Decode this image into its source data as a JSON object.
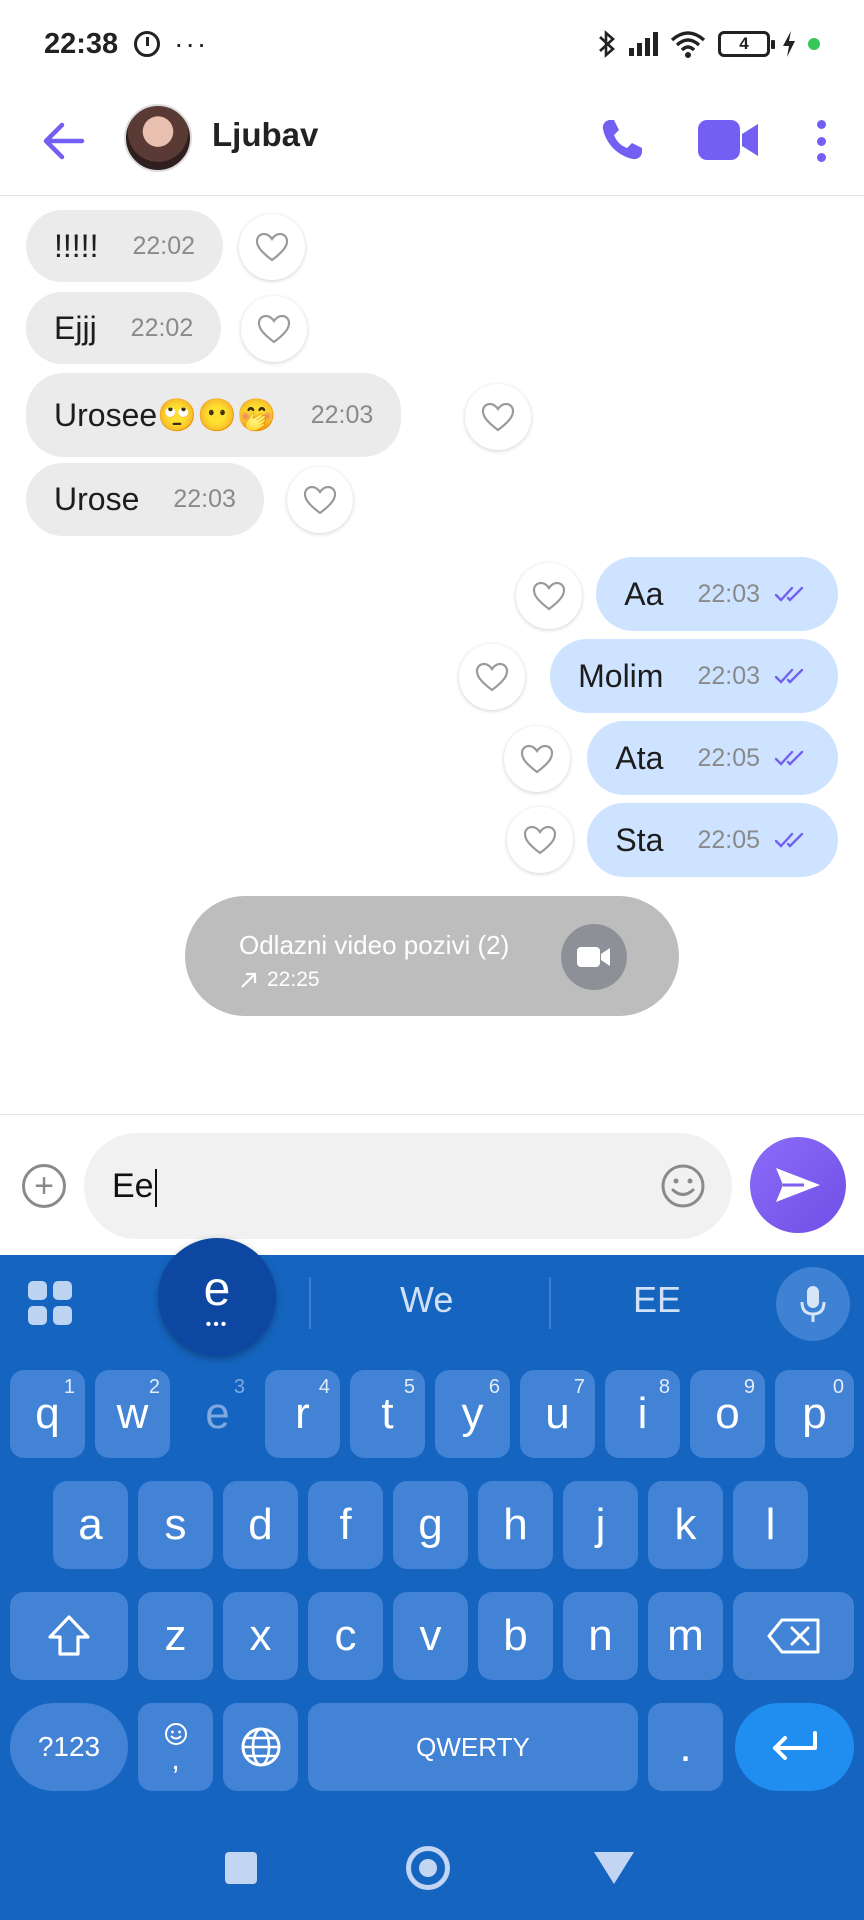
{
  "status_bar": {
    "time": "22:38",
    "dots": "···",
    "battery": "4"
  },
  "header": {
    "contact_name": "Ljubav"
  },
  "messages": {
    "incoming": [
      {
        "text": "!!!!!",
        "time": "22:02"
      },
      {
        "text": "Ejjj",
        "time": "22:02"
      },
      {
        "text": "Urosee🙄😶🤭",
        "time": "22:03"
      },
      {
        "text": "Urose",
        "time": "22:03"
      }
    ],
    "outgoing": [
      {
        "text": "Aa",
        "time": "22:03"
      },
      {
        "text": "Molim",
        "time": "22:03"
      },
      {
        "text": "Ata",
        "time": "22:05"
      },
      {
        "text": "Sta",
        "time": "22:05"
      }
    ],
    "call_event": {
      "title": "Odlazni video pozivi (2)",
      "time": "22:25"
    }
  },
  "composer": {
    "value": "Ee"
  },
  "keyboard": {
    "suggestions": [
      "e",
      "We",
      "EE"
    ],
    "suggestion_dots": "•••",
    "row1": [
      "q",
      "w",
      "e",
      "r",
      "t",
      "y",
      "u",
      "i",
      "o",
      "p"
    ],
    "row1_hints": [
      "1",
      "2",
      "3",
      "4",
      "5",
      "6",
      "7",
      "8",
      "9",
      "0"
    ],
    "row2": [
      "a",
      "s",
      "d",
      "f",
      "g",
      "h",
      "j",
      "k",
      "l"
    ],
    "row3": [
      "z",
      "x",
      "c",
      "v",
      "b",
      "n",
      "m"
    ],
    "symbols_label": "?123",
    "comma_label": ",",
    "space_label": "QWERTY",
    "period_label": "."
  },
  "colors": {
    "accent": "#7360f2",
    "outgoing_bubble": "#cde3ff",
    "incoming_bubble": "#ebebeb",
    "keyboard_bg": "#1565c0"
  }
}
